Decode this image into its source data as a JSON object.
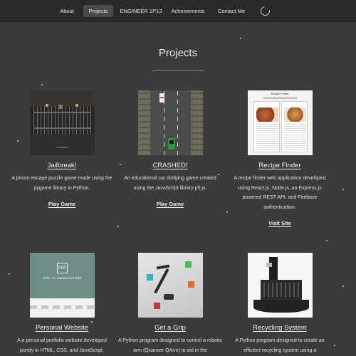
{
  "nav": {
    "items": [
      {
        "label": "About"
      },
      {
        "label": "Projects"
      },
      {
        "label": "ENGINEER 1P13"
      },
      {
        "label": "Acheivements"
      },
      {
        "label": "Contact Me"
      }
    ],
    "active": "Projects",
    "theme_icon": "moon-icon"
  },
  "page": {
    "title": "Projects"
  },
  "projects": [
    {
      "title": "Jailbreak!",
      "description": "A prison escape puzzle game made using the pygame library in Python.",
      "link": "Play Game",
      "thumb_caption": "I.JAILBREAK"
    },
    {
      "title": "CRASHED!",
      "description": "An educational car dodging game created using the JavaScript library p5.js.",
      "link": "Play Game"
    },
    {
      "title": "Recipe Finder",
      "description": "A recipe finder web application developed using React.js, Node.js, an Express.js powered REST API, and Firebase authentication.",
      "link": "Visit Site",
      "thumb_header": "Recipe Finder"
    },
    {
      "title": "Personal Website",
      "description": "A a personal portfolio website developed purely in HTML, CSS, and JavaScript."
    },
    {
      "title": "Get a Grip",
      "description": "A Python program designed to control a robotic arm (Quanser QArm) to aid in the"
    },
    {
      "title": "Recycling System",
      "description": "A Python program designed to create an efficient recycling system using a"
    }
  ],
  "site_thumb": {
    "logo": "MB",
    "hello": "Hello, I'm Mohammed Bilal"
  }
}
